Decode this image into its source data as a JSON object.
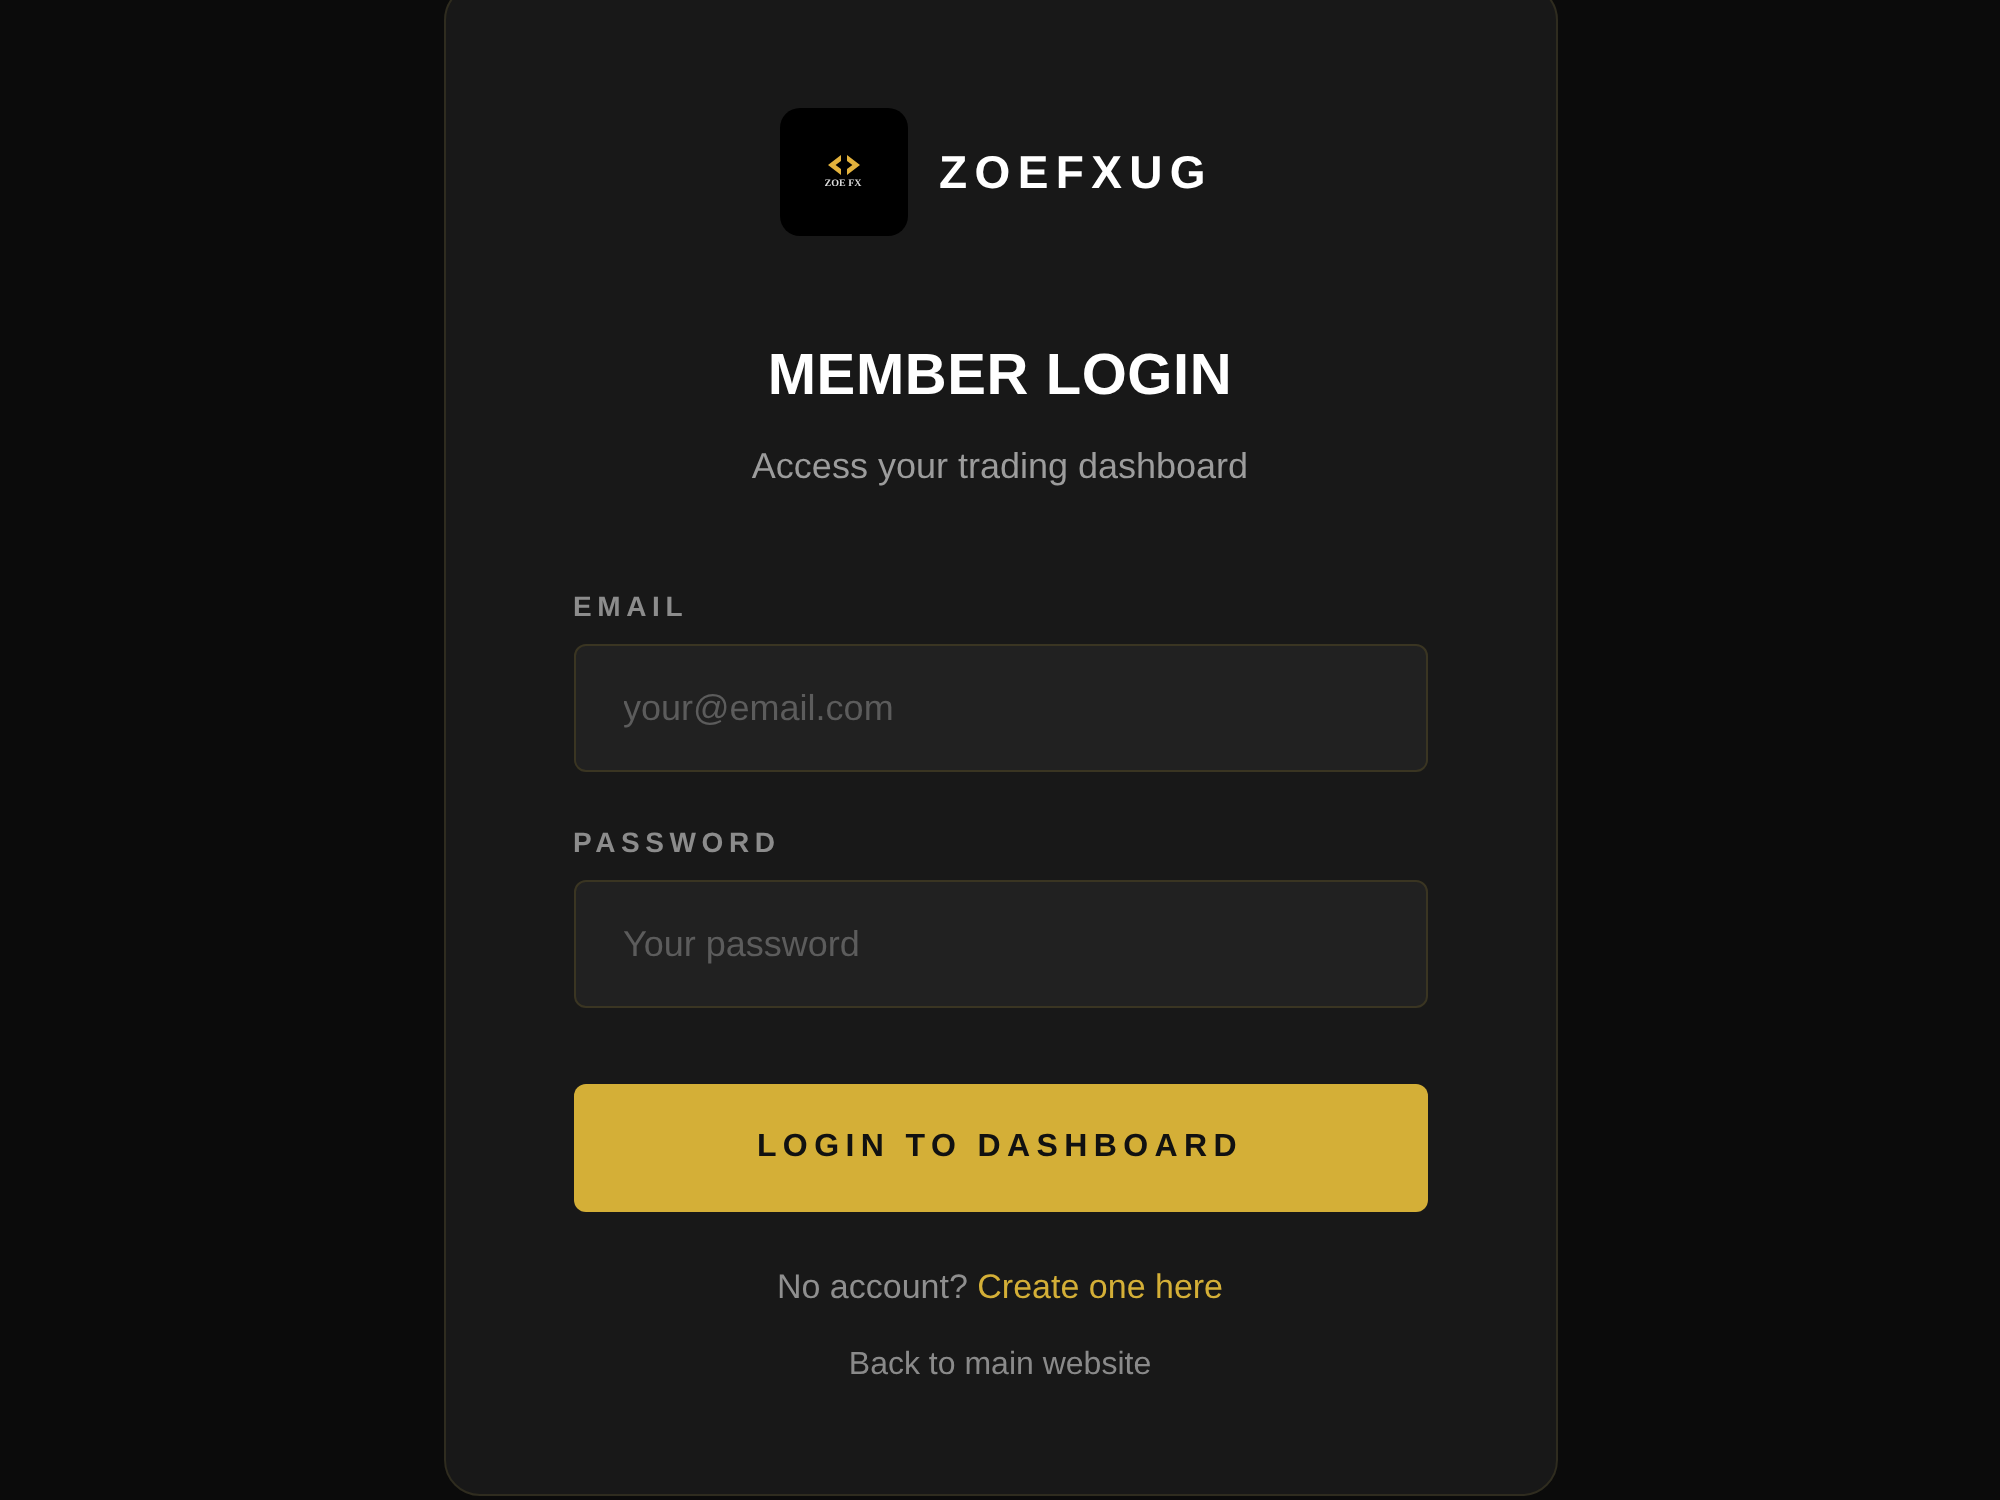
{
  "logo": {
    "badge_text": "ZOE FX",
    "name": "ZOEFXUG"
  },
  "heading": "MEMBER LOGIN",
  "subtitle": "Access your trading dashboard",
  "fields": [
    {
      "label": "EMAIL",
      "placeholder": "your@email.com"
    },
    {
      "label": "PASSWORD",
      "placeholder": "Your password"
    }
  ],
  "submit_button": "LOGIN TO DASHBOARD",
  "signup_prompt": {
    "text": "No account?",
    "link": "Create one here"
  },
  "back_link": "Back to main website"
}
